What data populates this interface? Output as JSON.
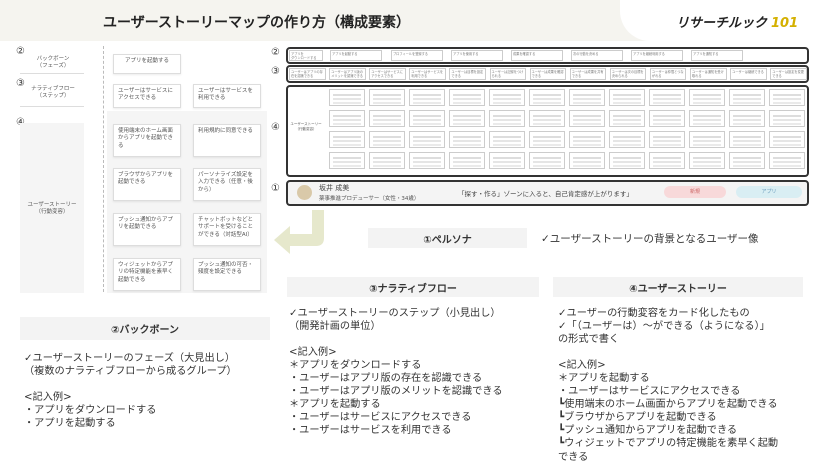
{
  "header": {
    "title": "ユーザーストーリーマップの作り方（構成要素）",
    "logo_text": "リサーチルック",
    "logo_num": "101"
  },
  "left_map": {
    "num_backbone": "②",
    "num_narrative": "③",
    "num_story": "④",
    "label_backbone": "バックボーン\n（フェーズ）",
    "label_narrative": "ナラティブフロー\n（ステップ）",
    "label_story": "ユーザーストーリー\n（行動変容）",
    "backbone_card": "アプリを起動する",
    "narrative_cards": [
      "ユーザーはサービスにアクセスできる",
      "ユーザーはサービスを利用できる"
    ],
    "story_cards": [
      "使用端末のホーム画面からアプリを起動できる",
      "利用規約に同意できる",
      "ブラウザからアプリを起動できる",
      "パーソナライズ設定を入力できる（任意・後から）",
      "プッシュ通知からアプリを起動できる",
      "チャットボットなどとサポートを受けることができる（対話型AI）",
      "ウィジェットからアプリの特定機能を素早く起動できる",
      "プッシュ通知の可否・頻度を設定できる"
    ]
  },
  "right_map": {
    "num_backbone": "②",
    "num_narrative": "③",
    "num_story": "④",
    "num_persona": "①",
    "story_row_label": "ユーザーストーリー\n（行動変容）",
    "backbone_row_label": "バックボーン\n（フェーズ）",
    "narrative_row_label": "ナラティブフロー\n（ステップ）",
    "backbone_cells": [
      "アプリを\nダウンロードする",
      "アプリを起動する",
      "プロフィールを登録する",
      "アプリを使用する",
      "成果を確認する",
      "次の行動を決める",
      "アプリを継続利用する",
      "アプリを通知する"
    ],
    "narrative_cells": [
      "ユーザーはアプリの存在を認識できる",
      "ユーザーはアプリ版のメリットを認識できる",
      "ユーザーはサービスにアクセスできる",
      "ユーザーはサービスを利用できる",
      "ユーザーは目標を設定できる",
      "ユーザーは記録をつけられる",
      "ユーザーは成果を確認できる",
      "ユーザーは成果を共有できる",
      "ユーザーは次の目標を決められる",
      "ユーザーは仲間とつながれる",
      "ユーザーは通知を受け取れる",
      "ユーザーは継続できる",
      "ユーザーは設定を変更できる"
    ],
    "persona_name": "坂井 成美",
    "persona_role": "薬事推進プロデューサー（女性・34歳）",
    "persona_quote": "「探す・作る」ゾーンに入ると、自己肯定感が上がります」",
    "persona_tag1": "新規",
    "persona_tag2": "アプリ"
  },
  "sections": {
    "persona_head": "①ペルソナ",
    "persona_desc": "✓ユーザーストーリーの背景となるユーザー像",
    "narrative_head": "③ナラティブフロー",
    "narrative_body": "✓ユーザーストーリーのステップ（小見出し）\n（開発計画の単位）\n\n<記入例>\n＊アプリをダウンロードする\n・ユーザーはアプリ版の存在を認識できる\n・ユーザーはアプリ版のメリットを認識できる\n＊アプリを起動する\n・ユーザーはサービスにアクセスできる\n・ユーザーはサービスを利用できる",
    "story_head": "④ユーザーストーリー",
    "story_body": "✓ユーザーの行動変容をカード化したもの\n✓「（ユーザーは）～ができる（ようになる）」\nの形式で書く\n\n<記入例>\n＊アプリを起動する\n・ユーザーはサービスにアクセスできる\n┗使用端末のホーム画面からアプリを起動できる\n┗ブラウザからアプリを起動できる\n┗プッシュ通知からアプリを起動できる\n┗ウィジェットでアプリの特定機能を素早く起動\nできる",
    "backbone_head": "②バックボーン",
    "backbone_body": "✓ユーザーストーリーのフェーズ（大見出し）\n（複数のナラティブフローから成るグループ）\n\n<記入例>\n・アプリをダウンロードする\n・アプリを起動する"
  },
  "colors": {
    "header_bg": "#f5f4ef",
    "logo_accent": "#d4b000",
    "arrow": "#e6e8cc",
    "tag1": "#f8d9da",
    "tag2": "#d9eef3",
    "persona_bg": "#f4f4f4"
  }
}
